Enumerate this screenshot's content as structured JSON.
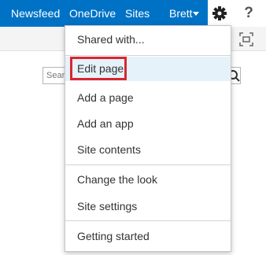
{
  "suite_bar": {
    "newsfeed": "Newsfeed",
    "onedrive": "OneDrive",
    "sites": "Sites",
    "user": "Brett",
    "help": "?"
  },
  "search": {
    "placeholder_visible": "Sear"
  },
  "menu": {
    "items": [
      {
        "label": "Shared with..."
      },
      {
        "label": "Edit page"
      },
      {
        "label": "Add a page"
      },
      {
        "label": "Add an app"
      },
      {
        "label": "Site contents"
      },
      {
        "label": "Change the look"
      },
      {
        "label": "Site settings"
      },
      {
        "label": "Getting started"
      }
    ]
  },
  "colors": {
    "suite_bar": "#0072c6",
    "highlight": "#d9262f",
    "hover": "#e6f2fa"
  },
  "icons": [
    "gear-icon",
    "help-icon",
    "focus-icon",
    "search-icon",
    "caret-down-icon"
  ]
}
